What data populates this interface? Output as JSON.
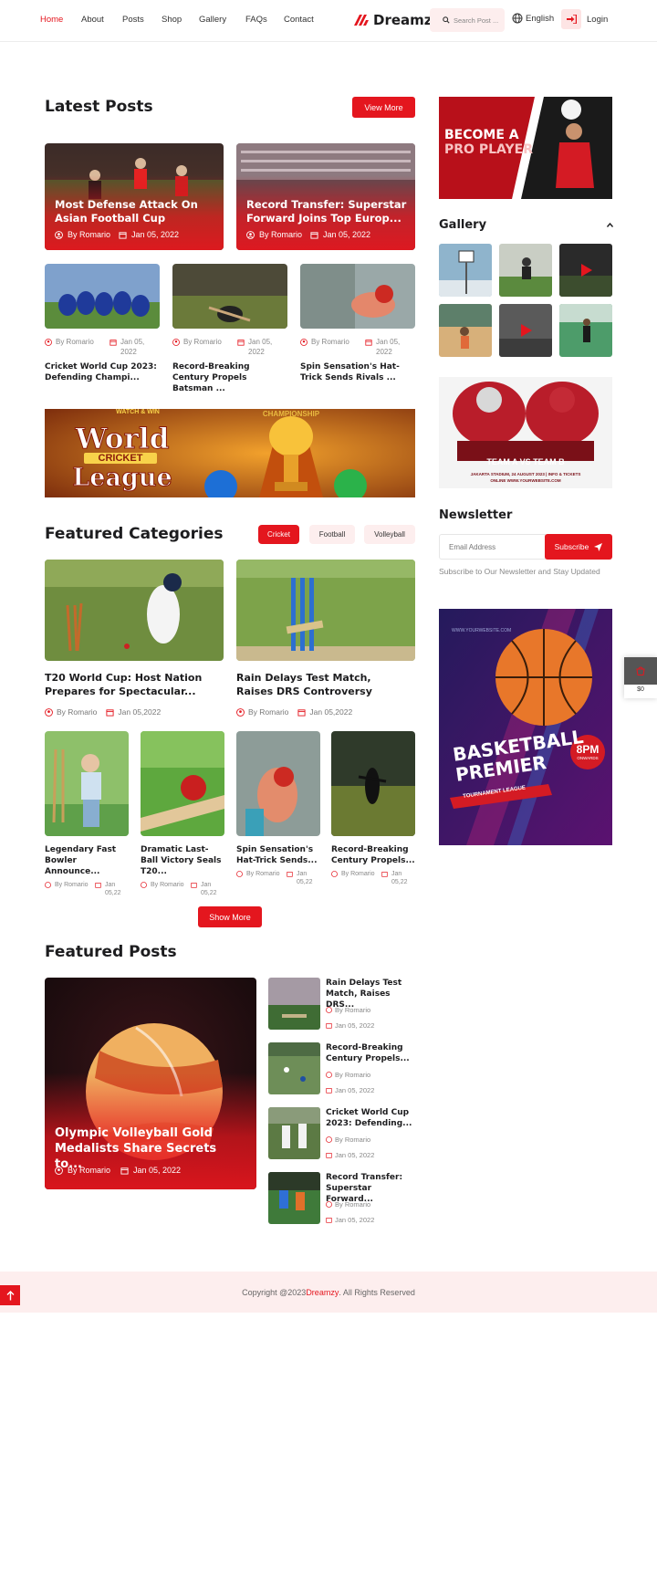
{
  "nav": {
    "items": [
      "Home",
      "About",
      "Posts",
      "Shop",
      "Gallery",
      "FAQs",
      "Contact"
    ],
    "active": "Home",
    "logo": "Dreamzy",
    "search_placeholder": "Search Post ...",
    "language": "English",
    "login": "Login"
  },
  "latest": {
    "title": "Latest Posts",
    "view_more": "View More",
    "big": [
      {
        "title": "Most Defense Attack On Asian Football Cup",
        "author": "By Romario",
        "date": "Jan 05, 2022"
      },
      {
        "title": "Record Transfer: Superstar Forward Joins Top Europ...",
        "author": "By Romario",
        "date": "Jan 05, 2022"
      }
    ],
    "small": [
      {
        "author": "By Romario",
        "date": "Jan 05, 2022",
        "title": "Cricket World Cup 2023: Defending Champi..."
      },
      {
        "author": "By Romario",
        "date": "Jan 05, 2022",
        "title": "Record-Breaking Century Propels Batsman ..."
      },
      {
        "author": "By Romario",
        "date": "Jan 05, 2022",
        "title": "Spin Sensation's Hat-Trick Sends Rivals ..."
      }
    ]
  },
  "banner": {
    "watch": "WATCH & WIN",
    "line1": "World",
    "line2": "CRICKET",
    "line3": "League",
    "champion": "CHAMPIONSHIP"
  },
  "featured_categories": {
    "title": "Featured Categories",
    "tabs": [
      "Cricket",
      "Football",
      "Volleyball"
    ],
    "active_tab": "Cricket",
    "big": [
      {
        "title": "T20 World Cup: Host Nation Prepares for Spectacular...",
        "author": "By Romario",
        "date": "Jan 05,2022"
      },
      {
        "title": "Rain Delays Test Match, Raises DRS Controversy",
        "author": "By Romario",
        "date": "Jan 05,2022"
      }
    ],
    "small": [
      {
        "title": "Legendary Fast Bowler Announce...",
        "author": "By Romario",
        "date": "Jan 05,22"
      },
      {
        "title": "Dramatic Last-Ball Victory Seals T20...",
        "author": "By Romario",
        "date": "Jan 05,22"
      },
      {
        "title": "Spin Sensation's Hat-Trick Sends...",
        "author": "By Romario",
        "date": "Jan 05,22"
      },
      {
        "title": "Record-Breaking Century Propels...",
        "author": "By Romario",
        "date": "Jan 05,22"
      }
    ],
    "show_more": "Show More"
  },
  "featured_posts": {
    "title": "Featured Posts",
    "main": {
      "title": "Olympic Volleyball Gold Medalists Share Secrets to...",
      "author": "By Romario",
      "date": "Jan 05, 2022"
    },
    "list": [
      {
        "title": "Rain Delays Test Match, Raises DRS...",
        "author": "By Romario",
        "date": "Jan 05, 2022"
      },
      {
        "title": "Record-Breaking Century Propels...",
        "author": "By Romario",
        "date": "Jan 05, 2022"
      },
      {
        "title": "Cricket World Cup 2023: Defending...",
        "author": "By Romario",
        "date": "Jan 05, 2022"
      },
      {
        "title": "Record Transfer: Superstar Forward...",
        "author": "By Romario",
        "date": "Jan 05, 2022"
      }
    ]
  },
  "sidebar": {
    "ad1": {
      "line1": "BECOME A",
      "line2": "PRO PLAYER"
    },
    "gallery_title": "Gallery",
    "ad2": {
      "match": "TEAM A VS TEAM B",
      "info": "JAKARTA STADIUM, 24 AUGUST 2023 | INFO & TICKETS",
      "web": "ONLINE WWW.YOURWEBSITE.COM"
    },
    "newsletter": {
      "title": "Newsletter",
      "placeholder": "Email Address",
      "button": "Subscribe",
      "text": "Subscribe to Our Newsletter and Stay Updated"
    },
    "ad3": {
      "site": "WWW.YOURWEBSITE.COM",
      "line1": "BASKETBALL",
      "line2": "PREMIER",
      "ribbon": "TOURNAMENT LEAGUE",
      "time": "8PM",
      "onwards": "ONWARDS"
    }
  },
  "cart": {
    "price": "$0"
  },
  "footer": {
    "prefix": "Copyright @2023 ",
    "brand": "Dreamzy",
    "suffix": ". All Rights Reserved"
  },
  "colors": {
    "accent": "#e4161e",
    "light": "#fdeeee"
  }
}
